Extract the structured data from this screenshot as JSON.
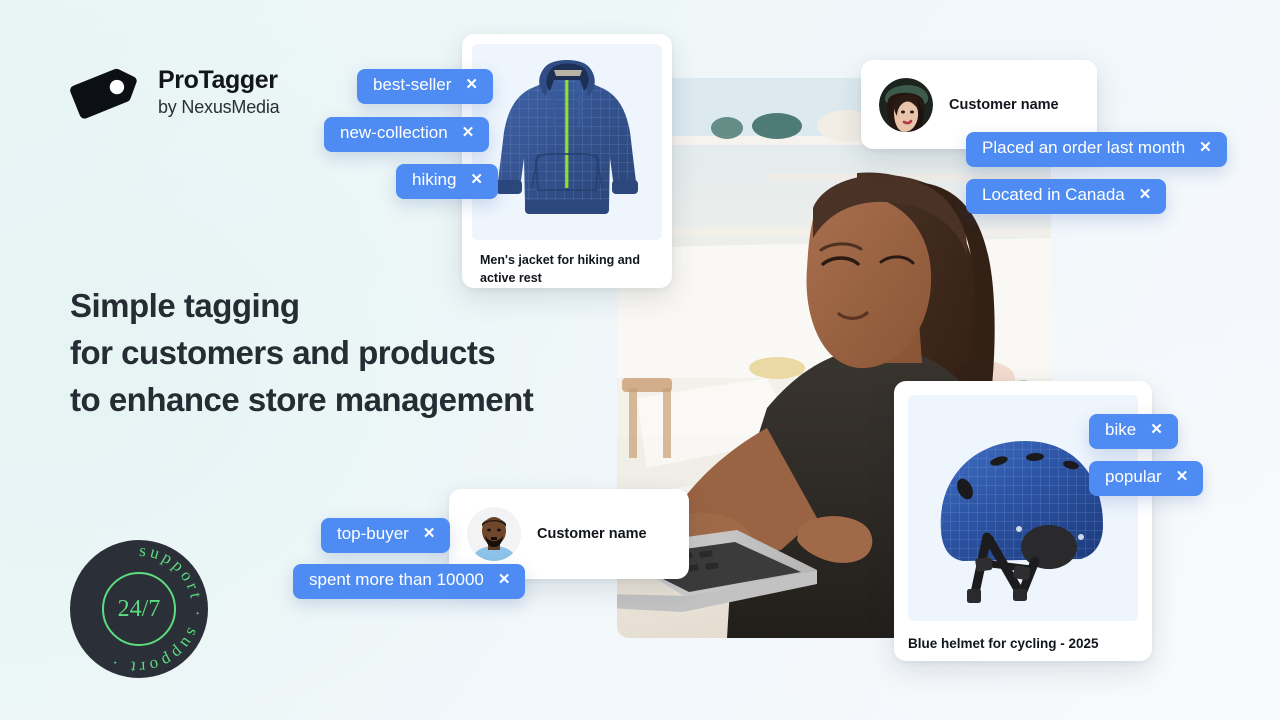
{
  "brand": {
    "name": "ProTagger",
    "tagline": "by NexusMedia",
    "logo_icon": "price-tag-icon"
  },
  "headline": {
    "line1": "Simple tagging",
    "line2": "for customers and products",
    "line3": "to enhance store management"
  },
  "colors": {
    "tag_blue": "#4e8cf3",
    "text_dark": "#252c33",
    "badge_dark": "#2b3038",
    "badge_green": "#5ddc7f",
    "card_media_bg": "#eef5fd",
    "background_start": "#e9f5f5",
    "background_end": "#f6f9fc"
  },
  "product_cards": [
    {
      "id": "jacket",
      "caption": "Men's jacket for hiking and active rest",
      "image_alt": "blue-hoodie-image",
      "tags": [
        {
          "label": "best-seller",
          "remove_icon": "close-icon"
        },
        {
          "label": "new-collection",
          "remove_icon": "close-icon"
        },
        {
          "label": "hiking",
          "remove_icon": "close-icon"
        }
      ]
    },
    {
      "id": "helmet",
      "caption": "Blue helmet for cycling - 2025",
      "image_alt": "blue-bike-helmet-image",
      "tags": [
        {
          "label": "bike",
          "remove_icon": "close-icon"
        },
        {
          "label": "popular",
          "remove_icon": "close-icon"
        }
      ]
    }
  ],
  "customer_cards": [
    {
      "id": "customer-top",
      "name": "Customer name",
      "avatar_alt": "woman-avatar",
      "tags": [
        {
          "label": "Placed an order last month",
          "remove_icon": "close-icon"
        },
        {
          "label": "Located in Canada",
          "remove_icon": "close-icon"
        }
      ]
    },
    {
      "id": "customer-bottom",
      "name": "Customer name",
      "avatar_alt": "man-avatar",
      "tags": [
        {
          "label": "top-buyer",
          "remove_icon": "close-icon"
        },
        {
          "label": "spent more than 10000",
          "remove_icon": "close-icon"
        }
      ]
    }
  ],
  "support_badge": {
    "center_text": "24/7",
    "ring_text": "support · support · "
  },
  "hero_photo": {
    "alt": "woman-working-on-laptop-in-kitchen"
  },
  "tag_close_glyph": "✕"
}
